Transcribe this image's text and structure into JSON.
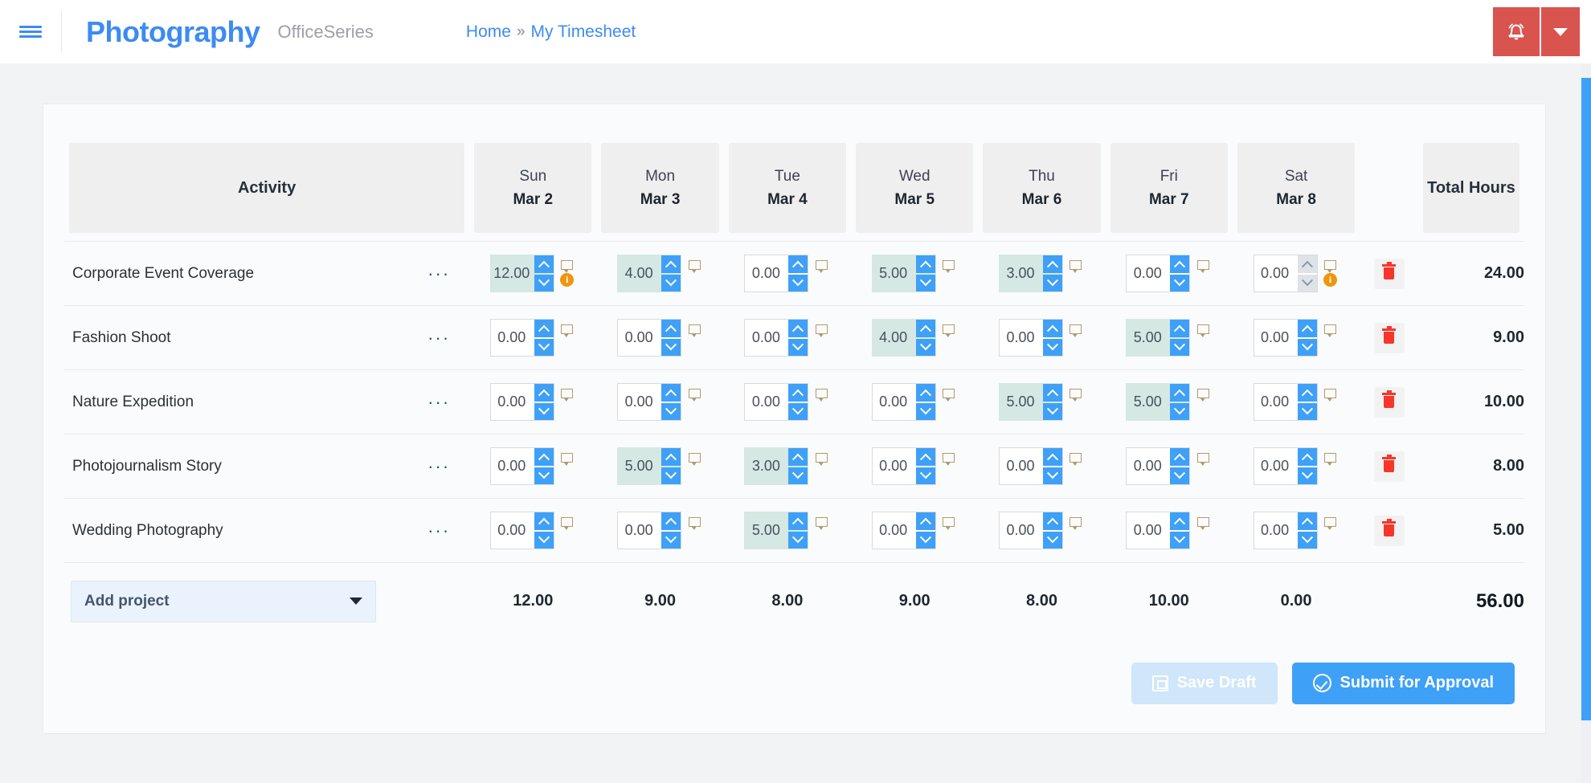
{
  "header": {
    "menu_icon": "hamburger-icon",
    "brand_title": "Photography",
    "brand_subtitle": "OfficeSeries",
    "breadcrumb": {
      "home": "Home",
      "separator": "»",
      "current": "My Timesheet"
    },
    "alert_icon": "bell-icon",
    "alert_caret_icon": "chevron-down-icon",
    "accent_color": "#3d8bf2",
    "alert_color": "#d9534f"
  },
  "table": {
    "activity_header": "Activity",
    "total_header": "Total Hours",
    "days": [
      {
        "dow": "Sun",
        "date": "Mar 2"
      },
      {
        "dow": "Mon",
        "date": "Mar 3"
      },
      {
        "dow": "Tue",
        "date": "Mar 4"
      },
      {
        "dow": "Wed",
        "date": "Mar 5"
      },
      {
        "dow": "Thu",
        "date": "Mar 6"
      },
      {
        "dow": "Fri",
        "date": "Mar 7"
      },
      {
        "dow": "Sat",
        "date": "Mar 8"
      }
    ],
    "row_menu_label": "···",
    "rows": [
      {
        "activity": "Corporate Event Coverage",
        "total": "24.00",
        "cells": [
          {
            "value": "12.00",
            "filled": true,
            "disabled": false,
            "info": true
          },
          {
            "value": "4.00",
            "filled": true,
            "disabled": false,
            "info": false
          },
          {
            "value": "0.00",
            "filled": false,
            "disabled": false,
            "info": false
          },
          {
            "value": "5.00",
            "filled": true,
            "disabled": false,
            "info": false
          },
          {
            "value": "3.00",
            "filled": true,
            "disabled": false,
            "info": false
          },
          {
            "value": "0.00",
            "filled": false,
            "disabled": false,
            "info": false
          },
          {
            "value": "0.00",
            "filled": false,
            "disabled": true,
            "info": true
          }
        ]
      },
      {
        "activity": "Fashion Shoot",
        "total": "9.00",
        "cells": [
          {
            "value": "0.00",
            "filled": false,
            "disabled": false,
            "info": false
          },
          {
            "value": "0.00",
            "filled": false,
            "disabled": false,
            "info": false
          },
          {
            "value": "0.00",
            "filled": false,
            "disabled": false,
            "info": false
          },
          {
            "value": "4.00",
            "filled": true,
            "disabled": false,
            "info": false
          },
          {
            "value": "0.00",
            "filled": false,
            "disabled": false,
            "info": false
          },
          {
            "value": "5.00",
            "filled": true,
            "disabled": false,
            "info": false
          },
          {
            "value": "0.00",
            "filled": false,
            "disabled": false,
            "info": false
          }
        ]
      },
      {
        "activity": "Nature Expedition",
        "total": "10.00",
        "cells": [
          {
            "value": "0.00",
            "filled": false,
            "disabled": false,
            "info": false
          },
          {
            "value": "0.00",
            "filled": false,
            "disabled": false,
            "info": false
          },
          {
            "value": "0.00",
            "filled": false,
            "disabled": false,
            "info": false
          },
          {
            "value": "0.00",
            "filled": false,
            "disabled": false,
            "info": false
          },
          {
            "value": "5.00",
            "filled": true,
            "disabled": false,
            "info": false
          },
          {
            "value": "5.00",
            "filled": true,
            "disabled": false,
            "info": false
          },
          {
            "value": "0.00",
            "filled": false,
            "disabled": false,
            "info": false
          }
        ]
      },
      {
        "activity": "Photojournalism Story",
        "total": "8.00",
        "cells": [
          {
            "value": "0.00",
            "filled": false,
            "disabled": false,
            "info": false
          },
          {
            "value": "5.00",
            "filled": true,
            "disabled": false,
            "info": false
          },
          {
            "value": "3.00",
            "filled": true,
            "disabled": false,
            "info": false
          },
          {
            "value": "0.00",
            "filled": false,
            "disabled": false,
            "info": false
          },
          {
            "value": "0.00",
            "filled": false,
            "disabled": false,
            "info": false
          },
          {
            "value": "0.00",
            "filled": false,
            "disabled": false,
            "info": false
          },
          {
            "value": "0.00",
            "filled": false,
            "disabled": false,
            "info": false
          }
        ]
      },
      {
        "activity": "Wedding Photography",
        "total": "5.00",
        "cells": [
          {
            "value": "0.00",
            "filled": false,
            "disabled": false,
            "info": false
          },
          {
            "value": "0.00",
            "filled": false,
            "disabled": false,
            "info": false
          },
          {
            "value": "5.00",
            "filled": true,
            "disabled": false,
            "info": false
          },
          {
            "value": "0.00",
            "filled": false,
            "disabled": false,
            "info": false
          },
          {
            "value": "0.00",
            "filled": false,
            "disabled": false,
            "info": false
          },
          {
            "value": "0.00",
            "filled": false,
            "disabled": false,
            "info": false
          },
          {
            "value": "0.00",
            "filled": false,
            "disabled": false,
            "info": false
          }
        ]
      }
    ],
    "footer": {
      "add_project_label": "Add project",
      "day_totals": [
        "12.00",
        "9.00",
        "8.00",
        "9.00",
        "8.00",
        "10.00",
        "0.00"
      ],
      "grand_total": "56.00"
    }
  },
  "actions": {
    "save_draft_label": "Save Draft",
    "save_draft_icon": "save-icon",
    "save_draft_disabled": true,
    "submit_label": "Submit for Approval",
    "submit_icon": "check-circle-icon"
  }
}
